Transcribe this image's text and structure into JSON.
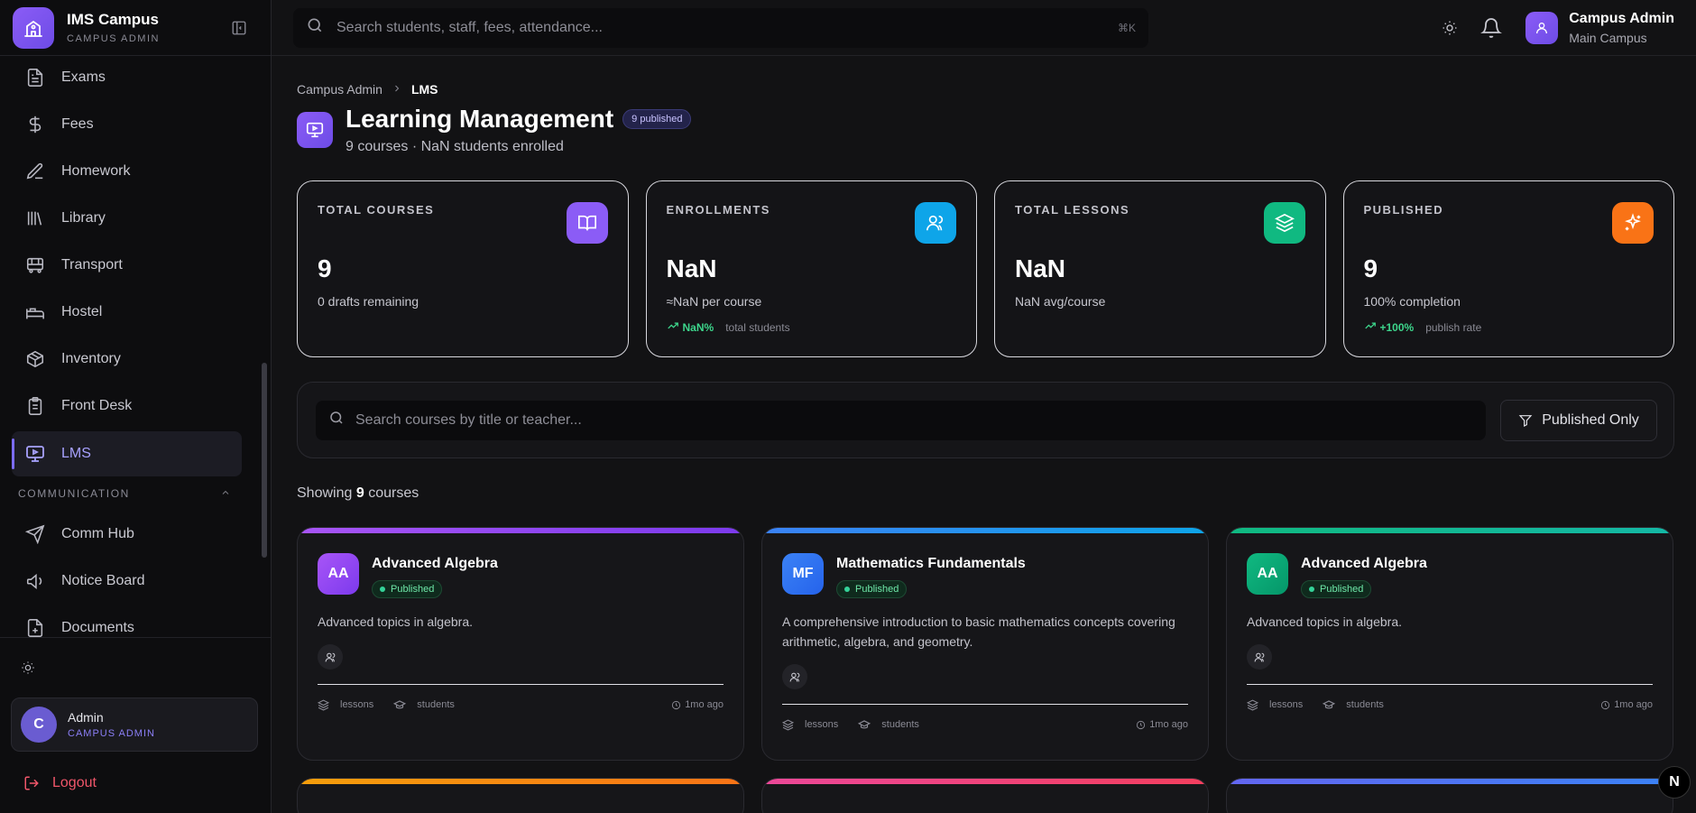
{
  "sidebar": {
    "brand_name": "IMS Campus",
    "brand_role": "CAMPUS ADMIN",
    "items": [
      {
        "label": "Exams",
        "icon": "exams-icon"
      },
      {
        "label": "Fees",
        "icon": "dollar-icon"
      },
      {
        "label": "Homework",
        "icon": "pencil-icon"
      },
      {
        "label": "Library",
        "icon": "library-icon"
      },
      {
        "label": "Transport",
        "icon": "bus-icon"
      },
      {
        "label": "Hostel",
        "icon": "bed-icon"
      },
      {
        "label": "Inventory",
        "icon": "package-icon"
      },
      {
        "label": "Front Desk",
        "icon": "clipboard-icon"
      },
      {
        "label": "LMS",
        "icon": "presentation-icon",
        "active": true
      }
    ],
    "section_communication": "COMMUNICATION",
    "comm_items": [
      {
        "label": "Comm Hub",
        "icon": "send-icon"
      },
      {
        "label": "Notice Board",
        "icon": "megaphone-icon"
      },
      {
        "label": "Documents",
        "icon": "document-icon"
      }
    ],
    "user": {
      "initial": "C",
      "name": "Admin",
      "role": "CAMPUS ADMIN"
    },
    "logout_label": "Logout"
  },
  "topbar": {
    "search_placeholder": "Search students, staff, fees, attendance...",
    "shortcut": "⌘K",
    "user_name": "Campus Admin",
    "user_campus": "Main Campus"
  },
  "breadcrumb": {
    "root": "Campus Admin",
    "current": "LMS"
  },
  "header": {
    "title": "Learning Management",
    "badge": "9 published",
    "subtitle": "9 courses · NaN students enrolled"
  },
  "stats": [
    {
      "label": "TOTAL COURSES",
      "value": "9",
      "sub": "0 drafts remaining",
      "icon": "book-open-icon",
      "color": "#8b5cf6"
    },
    {
      "label": "ENROLLMENTS",
      "value": "NaN",
      "sub": "≈NaN per course",
      "trend_pct": "NaN%",
      "trend_label": "total students",
      "icon": "users-icon",
      "color": "#0ea5e9"
    },
    {
      "label": "TOTAL LESSONS",
      "value": "NaN",
      "sub": "NaN avg/course",
      "icon": "layers-icon",
      "color": "#10b981"
    },
    {
      "label": "PUBLISHED",
      "value": "9",
      "sub": "100% completion",
      "trend_pct": "+100%",
      "trend_label": "publish rate",
      "icon": "sparkles-icon",
      "color": "#f97316"
    }
  ],
  "filters": {
    "search_placeholder": "Search courses by title or teacher...",
    "filter_label": "Published Only"
  },
  "showing": {
    "prefix": "Showing",
    "count": "9",
    "suffix": "courses"
  },
  "courses": [
    {
      "initials": "AA",
      "title": "Advanced Algebra",
      "status": "Published",
      "description": "Advanced topics in algebra.",
      "lessons_label": "lessons",
      "students_label": "students",
      "time": "1mo ago",
      "accent": "#a855f7"
    },
    {
      "initials": "MF",
      "title": "Mathematics Fundamentals",
      "status": "Published",
      "description": "A comprehensive introduction to basic mathematics concepts covering arithmetic, algebra, and geometry.",
      "lessons_label": "lessons",
      "students_label": "students",
      "time": "1mo ago",
      "accent": "#3b82f6"
    },
    {
      "initials": "AA",
      "title": "Advanced Algebra",
      "status": "Published",
      "description": "Advanced topics in algebra.",
      "lessons_label": "lessons",
      "students_label": "students",
      "time": "1mo ago",
      "accent": "#10b981"
    }
  ],
  "row2_accents": [
    "#f59e0b",
    "#ec4899",
    "#6366f1"
  ],
  "corner_button": "N"
}
